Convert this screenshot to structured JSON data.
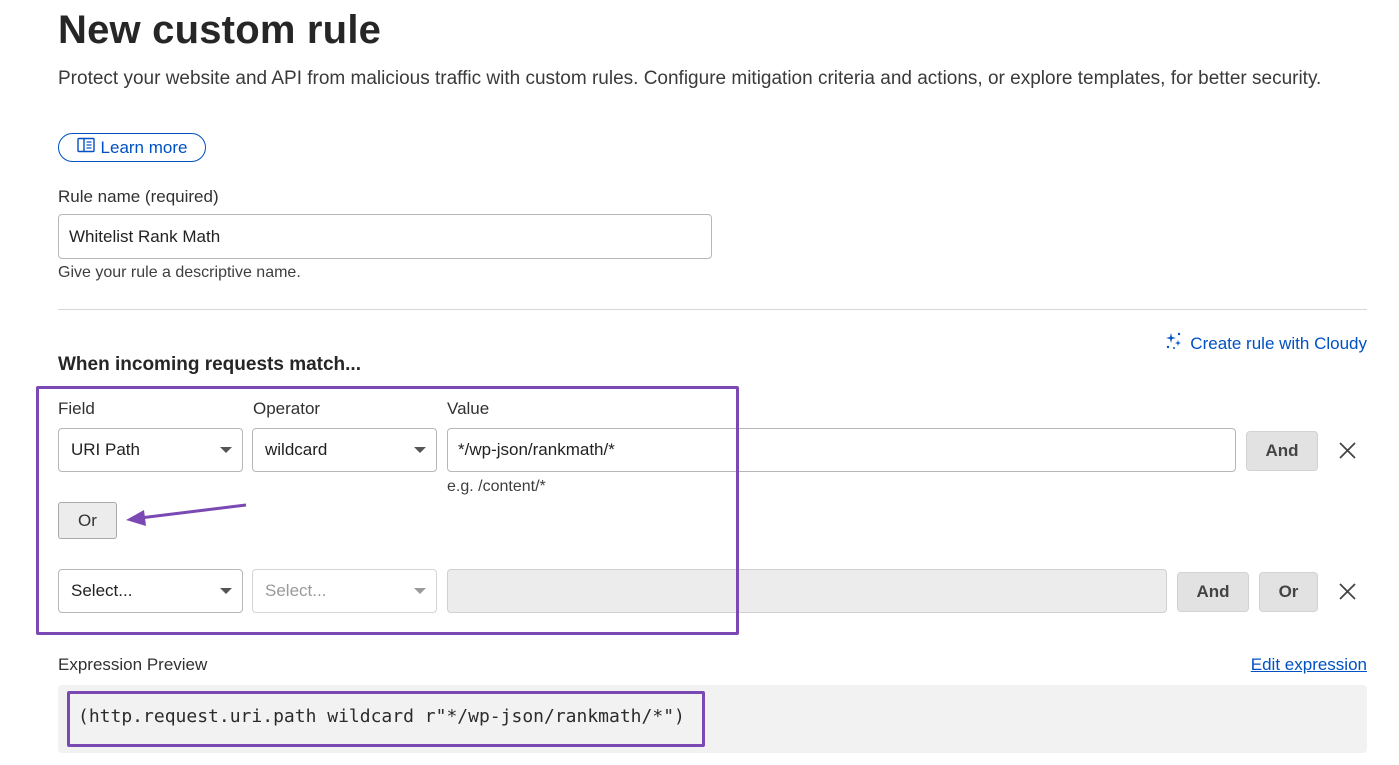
{
  "page": {
    "title": "New custom rule",
    "description": "Protect your website and API from malicious traffic with custom rules. Configure mitigation criteria and actions, or explore templates, for better security.",
    "learn_more": "Learn more"
  },
  "rule_name": {
    "label": "Rule name (required)",
    "value": "Whitelist Rank Math",
    "hint": "Give your rule a descriptive name."
  },
  "cloudy_link": "Create rule with Cloudy",
  "match_section": {
    "title": "When incoming requests match...",
    "headers": {
      "field": "Field",
      "operator": "Operator",
      "value": "Value"
    },
    "row1": {
      "field": "URI Path",
      "operator": "wildcard",
      "value": "*/wp-json/rankmath/*",
      "value_hint": "e.g. /content/*",
      "and_label": "And"
    },
    "or_label": "Or",
    "row2": {
      "field_placeholder": "Select...",
      "operator_placeholder": "Select...",
      "value": "",
      "and_label": "And",
      "or_label": "Or"
    }
  },
  "expression": {
    "label": "Expression Preview",
    "edit_label": "Edit expression",
    "code": "(http.request.uri.path wildcard r\"*/wp-json/rankmath/*\")"
  },
  "colors": {
    "accent_blue": "#0051c3",
    "annotation_purple": "#7b49b4"
  },
  "icons": [
    "book-icon",
    "sparkle-icon",
    "chevron-down-icon",
    "close-icon",
    "arrow-annotation"
  ]
}
